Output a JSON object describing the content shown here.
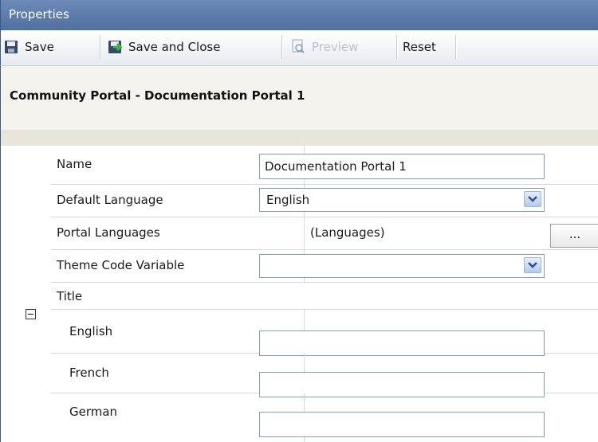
{
  "window": {
    "title": "Properties"
  },
  "toolbar": {
    "save_label": "Save",
    "save_close_label": "Save and Close",
    "preview_label": "Preview",
    "reset_label": "Reset"
  },
  "header": {
    "title": "Community Portal - Documentation Portal 1"
  },
  "form": {
    "name_label": "Name",
    "name_value": "Documentation Portal 1",
    "default_language_label": "Default Language",
    "default_language_value": "English",
    "portal_languages_label": "Portal Languages",
    "portal_languages_value": "(Languages)",
    "portal_languages_button": "...",
    "theme_label": "Theme Code Variable",
    "theme_value": "",
    "title_group_label": "Title",
    "title_languages": [
      {
        "label": "English",
        "value": ""
      },
      {
        "label": "French",
        "value": ""
      },
      {
        "label": "German",
        "value": ""
      }
    ]
  }
}
